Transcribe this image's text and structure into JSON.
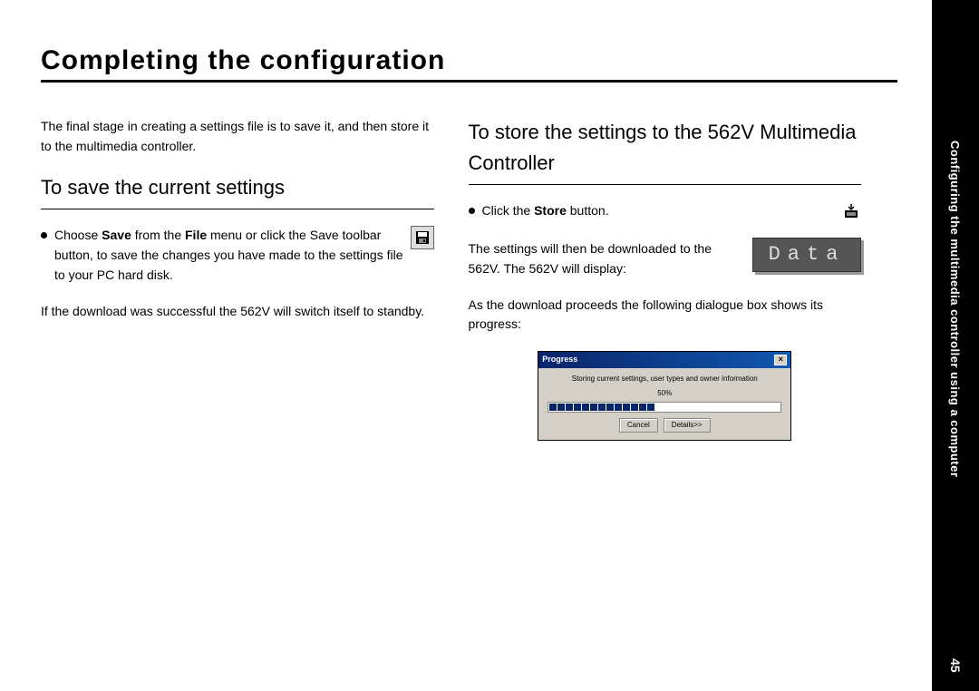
{
  "sidebar": {
    "section": "Configuring the multimedia controller using a computer",
    "page_number": "45"
  },
  "title": "Completing the configuration",
  "left": {
    "intro": "The final stage in creating a settings file is to save it, and then store it to the multimedia controller.",
    "section_title": "To save the current settings",
    "bullet_pre": "Choose ",
    "bullet_bold1": "Save",
    "bullet_mid": " from the ",
    "bullet_bold2": "File",
    "bullet_post": " menu or click the Save toolbar button, to save the changes you have made to the settings file to your PC hard disk.",
    "after": "If the download was successful the 562V will switch itself to standby."
  },
  "right": {
    "section_title": "To store the settings to the 562V Multimedia Controller",
    "bullet_pre": "Click the ",
    "bullet_bold": "Store",
    "bullet_post": " button.",
    "download_text": "The settings will then be downloaded to the 562V. The 562V will display:",
    "data_display": "Data",
    "progress_intro": "As the download proceeds the following dialogue box shows its progress:"
  },
  "dialog": {
    "title": "Progress",
    "message": "Storing current settings, user types and owner information",
    "percent": "50%",
    "cancel": "Cancel",
    "details": "Details>>"
  }
}
